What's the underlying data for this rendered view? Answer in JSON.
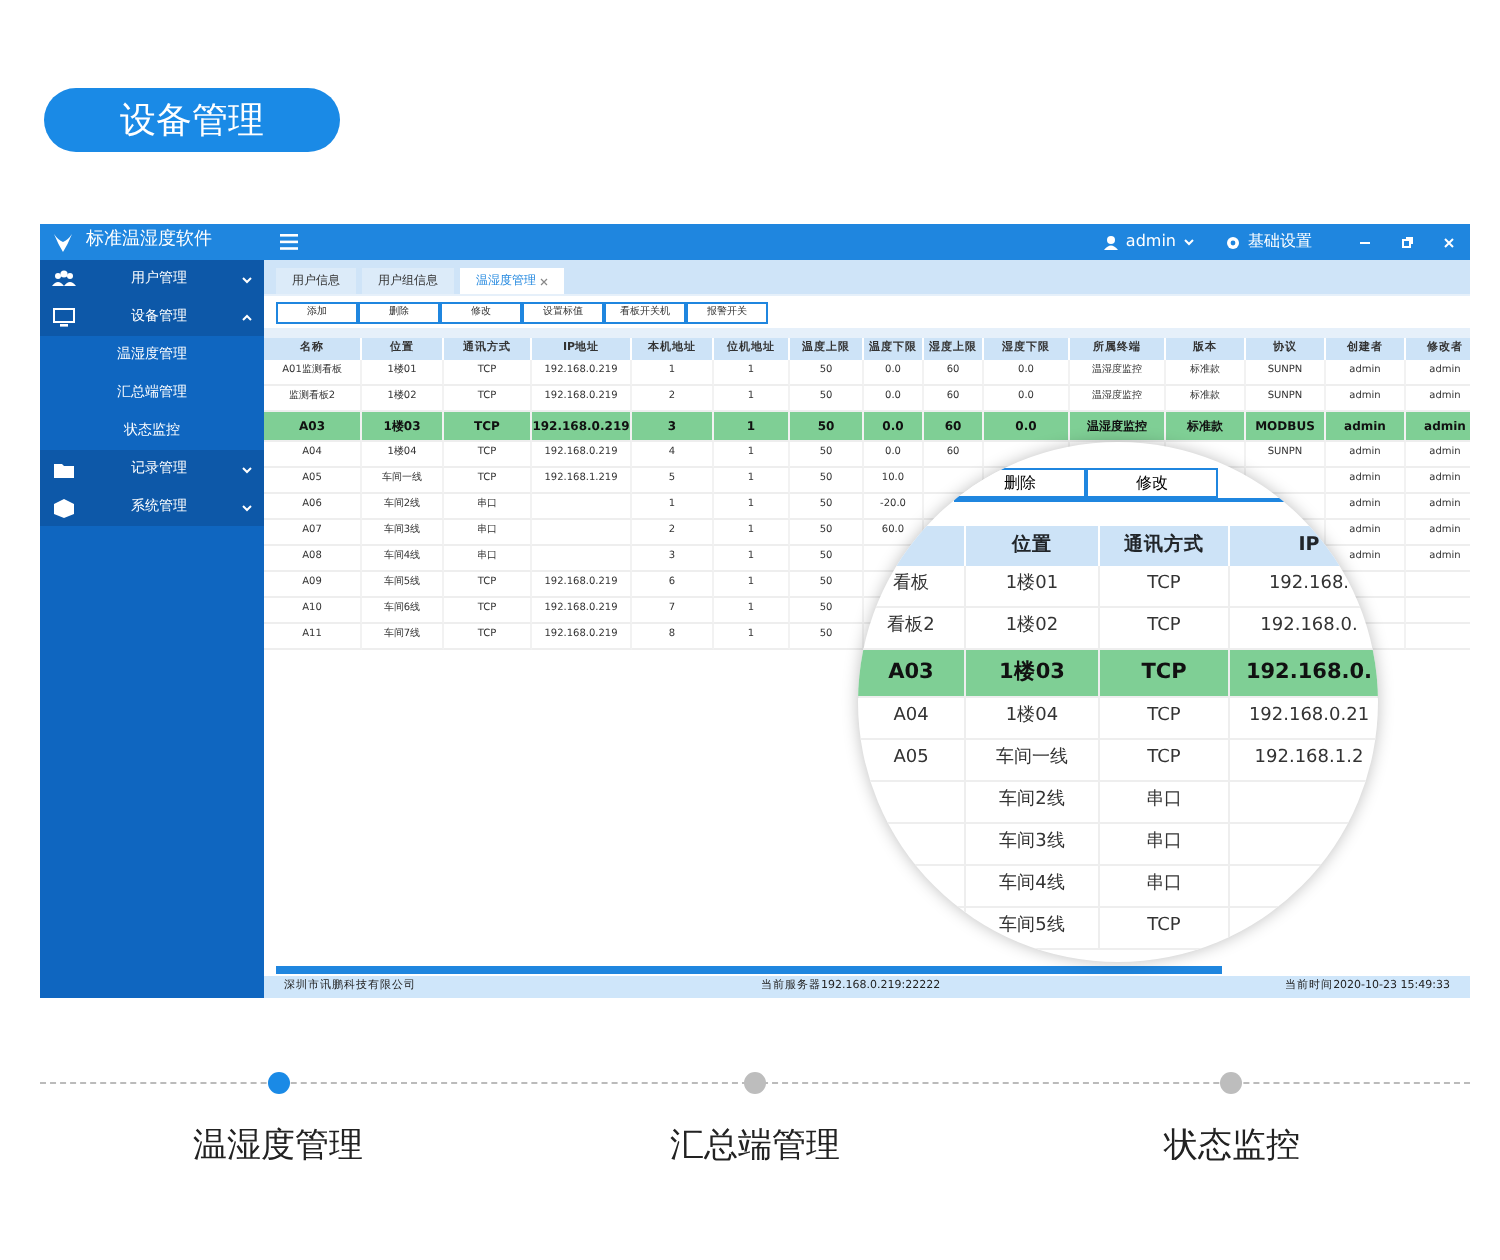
{
  "section_button": {
    "label": "设备管理"
  },
  "window": {
    "title": "标准温湿度软件",
    "user": "admin",
    "settings": "基础设置"
  },
  "sidebar": {
    "items": [
      {
        "label": "用户管理",
        "expanded": false
      },
      {
        "label": "设备管理",
        "expanded": true,
        "children": [
          {
            "label": "温湿度管理"
          },
          {
            "label": "汇总端管理"
          },
          {
            "label": "状态监控"
          }
        ]
      },
      {
        "label": "记录管理",
        "expanded": false
      },
      {
        "label": "系统管理",
        "expanded": false
      }
    ]
  },
  "tabs": [
    {
      "label": "用户信息",
      "selected": false,
      "closable": false
    },
    {
      "label": "用户组信息",
      "selected": false,
      "closable": false
    },
    {
      "label": "温湿度管理",
      "selected": true,
      "closable": true
    }
  ],
  "toolbar": [
    "添加",
    "删除",
    "修改",
    "设置标值",
    "看板开关机",
    "报警开关"
  ],
  "table": {
    "columns": [
      "名称",
      "位置",
      "通讯方式",
      "IP地址",
      "本机地址",
      "位机地址",
      "温度上限",
      "温度下限",
      "湿度上限",
      "湿度下限",
      "所属终端",
      "版本",
      "协议",
      "创建者",
      "修改者"
    ],
    "rows": [
      {
        "selected": false,
        "cells": [
          "A01监测看板",
          "1楼01",
          "TCP",
          "192.168.0.219",
          "1",
          "1",
          "50",
          "0.0",
          "60",
          "0.0",
          "温湿度监控",
          "标准款",
          "SUNPN",
          "admin",
          "admin"
        ]
      },
      {
        "selected": false,
        "cells": [
          "监测看板2",
          "1楼02",
          "TCP",
          "192.168.0.219",
          "2",
          "1",
          "50",
          "0.0",
          "60",
          "0.0",
          "温湿度监控",
          "标准款",
          "SUNPN",
          "admin",
          "admin"
        ]
      },
      {
        "selected": true,
        "cells": [
          "A03",
          "1楼03",
          "TCP",
          "192.168.0.219",
          "3",
          "1",
          "50",
          "0.0",
          "60",
          "0.0",
          "温湿度监控",
          "标准款",
          "MODBUS",
          "admin",
          "admin"
        ]
      },
      {
        "selected": false,
        "cells": [
          "A04",
          "1楼04",
          "TCP",
          "192.168.0.219",
          "4",
          "1",
          "50",
          "0.0",
          "60",
          null,
          null,
          null,
          "SUNPN",
          "admin",
          "admin"
        ]
      },
      {
        "selected": false,
        "cells": [
          "A05",
          "车间一线",
          "TCP",
          "192.168.1.219",
          "5",
          "1",
          "50",
          "10.0",
          null,
          null,
          null,
          null,
          null,
          "admin",
          "admin"
        ]
      },
      {
        "selected": false,
        "cells": [
          "A06",
          "车间2线",
          "串口",
          null,
          "1",
          "1",
          "50",
          "-20.0",
          null,
          null,
          null,
          null,
          null,
          "admin",
          "admin"
        ]
      },
      {
        "selected": false,
        "cells": [
          "A07",
          "车间3线",
          "串口",
          null,
          "2",
          "1",
          "50",
          "60.0",
          null,
          null,
          null,
          null,
          null,
          "admin",
          "admin"
        ]
      },
      {
        "selected": false,
        "cells": [
          "A08",
          "车间4线",
          "串口",
          null,
          "3",
          "1",
          "50",
          null,
          null,
          null,
          null,
          null,
          null,
          "admin",
          "admin"
        ]
      },
      {
        "selected": false,
        "cells": [
          "A09",
          "车间5线",
          "TCP",
          "192.168.0.219",
          "6",
          "1",
          "50",
          null,
          null,
          null,
          null,
          null,
          null,
          null,
          null
        ]
      },
      {
        "selected": false,
        "cells": [
          "A10",
          "车间6线",
          "TCP",
          "192.168.0.219",
          "7",
          "1",
          "50",
          null,
          null,
          null,
          null,
          null,
          null,
          null,
          null
        ]
      },
      {
        "selected": false,
        "cells": [
          "A11",
          "车间7线",
          "TCP",
          "192.168.0.219",
          "8",
          "1",
          "50",
          null,
          null,
          null,
          null,
          null,
          null,
          null,
          null
        ]
      }
    ]
  },
  "magnifier": {
    "buttons": [
      "删除",
      "修改"
    ],
    "columns": [
      null,
      "位置",
      "通讯方式",
      "IP"
    ],
    "rows": [
      {
        "selected": false,
        "cells": [
          "看板",
          "1楼01",
          "TCP",
          "192.168."
        ]
      },
      {
        "selected": false,
        "cells": [
          "看板2",
          "1楼02",
          "TCP",
          "192.168.0."
        ]
      },
      {
        "selected": true,
        "cells": [
          "A03",
          "1楼03",
          "TCP",
          "192.168.0."
        ]
      },
      {
        "selected": false,
        "cells": [
          "A04",
          "1楼04",
          "TCP",
          "192.168.0.21"
        ]
      },
      {
        "selected": false,
        "cells": [
          "A05",
          "车间一线",
          "TCP",
          "192.168.1.2"
        ]
      },
      {
        "selected": false,
        "cells": [
          null,
          "车间2线",
          "串口",
          null
        ]
      },
      {
        "selected": false,
        "cells": [
          null,
          "车间3线",
          "串口",
          null
        ]
      },
      {
        "selected": false,
        "cells": [
          null,
          "车间4线",
          "串口",
          null
        ]
      },
      {
        "selected": false,
        "cells": [
          null,
          "车间5线",
          "TCP"
        ]
      }
    ]
  },
  "status_bar": {
    "company": "深圳市讯鹏科技有限公司",
    "server": "当前服务器192.168.0.219:22222",
    "time": "当前时间2020-10-23 15:49:33"
  },
  "steps": [
    {
      "label": "温湿度管理",
      "selected": true
    },
    {
      "label": "汇总端管理",
      "selected": false
    },
    {
      "label": "状态监控",
      "selected": false
    }
  ]
}
